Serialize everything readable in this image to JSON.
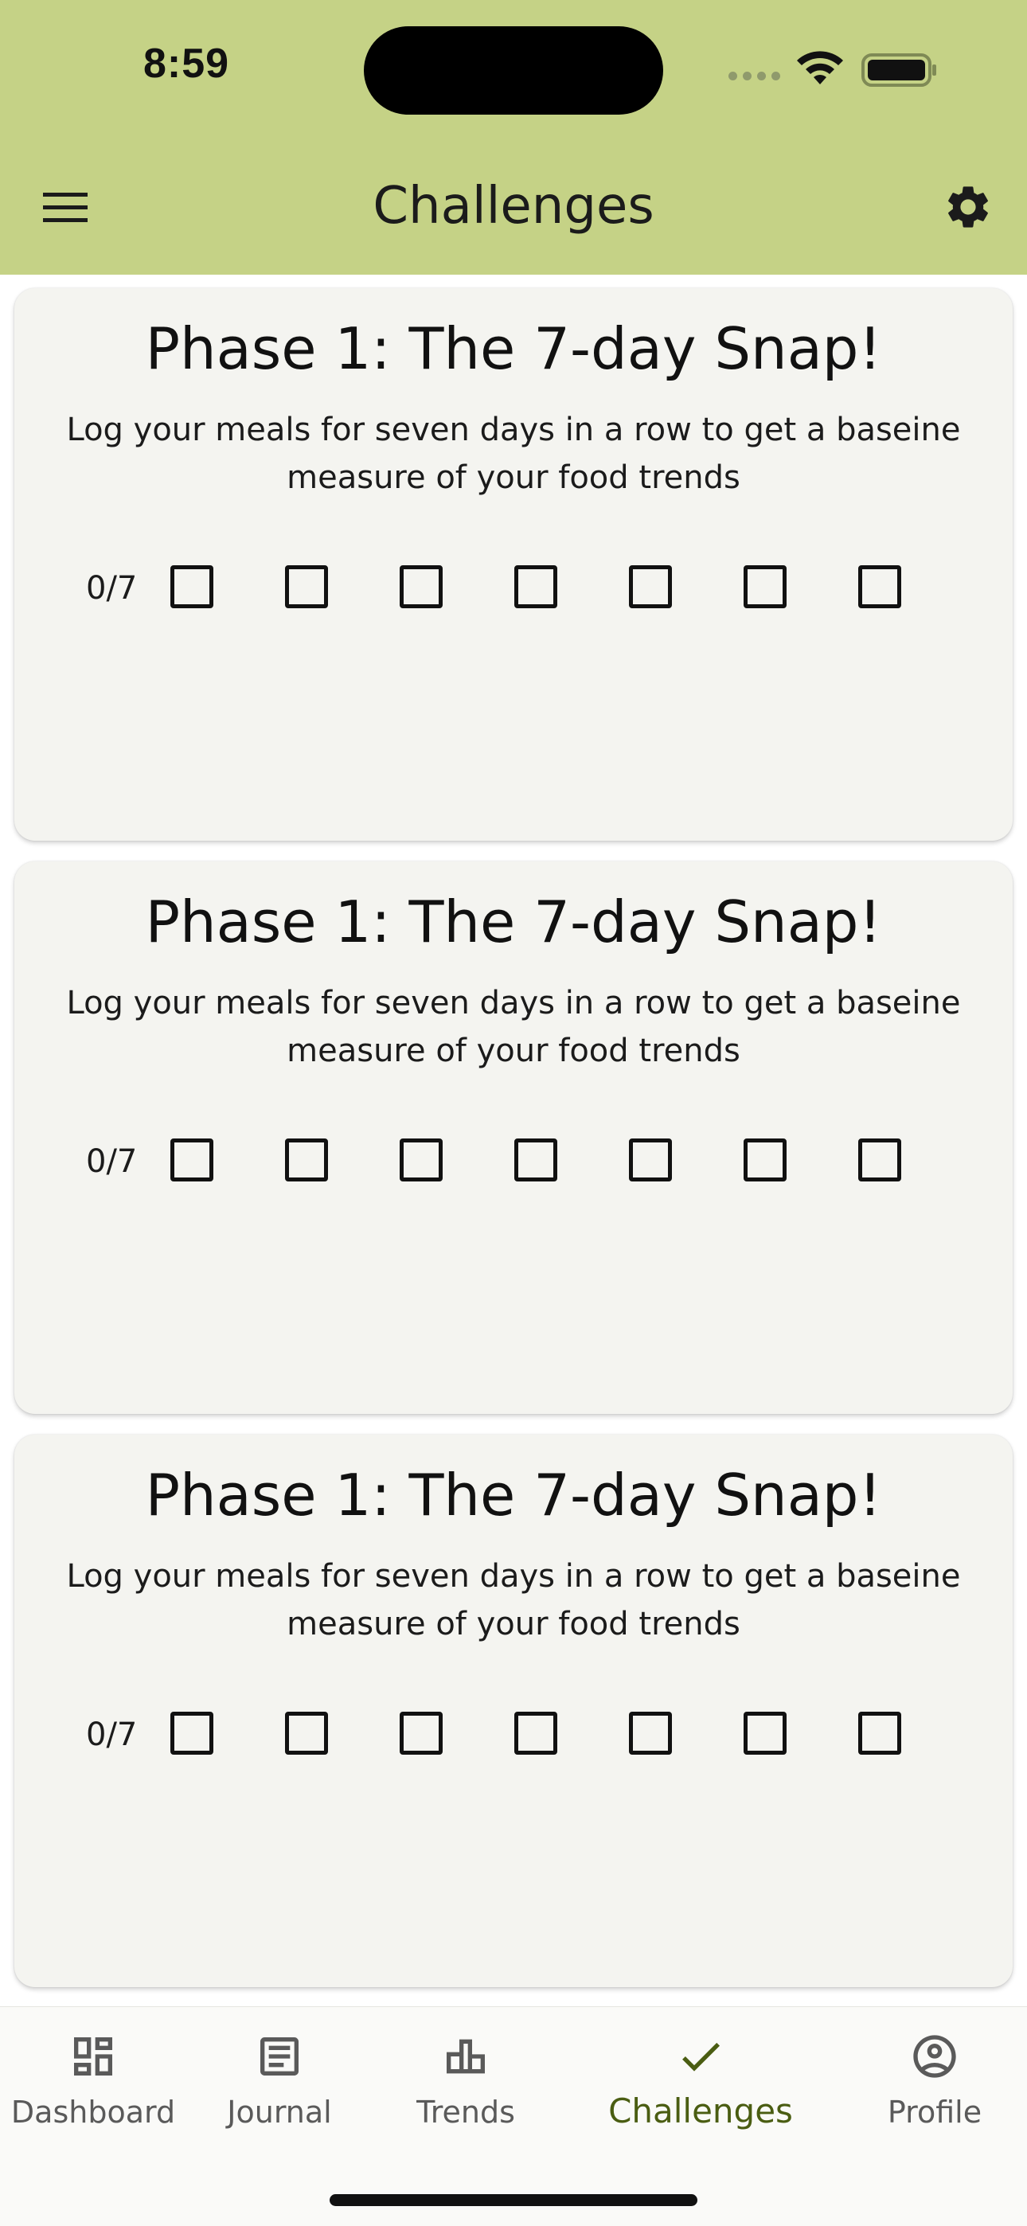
{
  "status_bar": {
    "time": "8:59"
  },
  "header": {
    "title": "Challenges",
    "background_color": "#c5d286",
    "menu_icon": "hamburger-menu-icon",
    "settings_icon": "gear-icon"
  },
  "cards": [
    {
      "title": "Phase 1: The 7-day Snap!",
      "description": "Log your meals for seven days in a row to get a baseine measure of your food trends",
      "progress": "0/7",
      "days_completed": 0,
      "days_total": 7
    },
    {
      "title": "Phase 1: The 7-day Snap!",
      "description": "Log your meals for seven days in a row to get a baseine measure of your food trends",
      "progress": "0/7",
      "days_completed": 0,
      "days_total": 7
    },
    {
      "title": "Phase 1: The 7-day Snap!",
      "description": "Log your meals for seven days in a row to get a baseine measure of your food trends",
      "progress": "0/7",
      "days_completed": 0,
      "days_total": 7
    }
  ],
  "bottom_nav": {
    "active_color": "#4a5d12",
    "items": [
      {
        "label": "Dashboard",
        "icon": "dashboard-icon",
        "active": false
      },
      {
        "label": "Journal",
        "icon": "journal-icon",
        "active": false
      },
      {
        "label": "Trends",
        "icon": "bar-chart-icon",
        "active": false
      },
      {
        "label": "Challenges",
        "icon": "check-icon",
        "active": true
      },
      {
        "label": "Profile",
        "icon": "profile-icon",
        "active": false
      }
    ]
  }
}
